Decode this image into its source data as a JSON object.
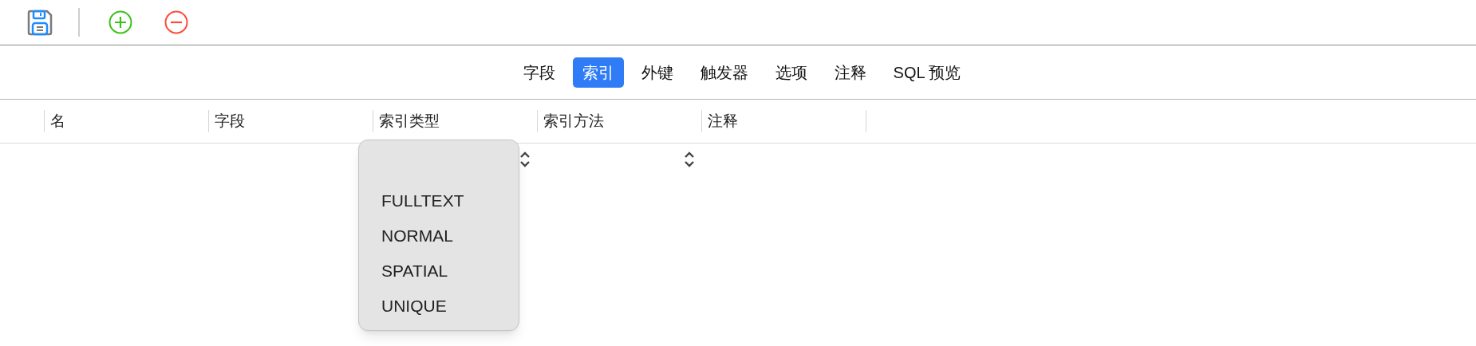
{
  "tabs": [
    {
      "label": "字段",
      "selected": false
    },
    {
      "label": "索引",
      "selected": true
    },
    {
      "label": "外键",
      "selected": false
    },
    {
      "label": "触发器",
      "selected": false
    },
    {
      "label": "选项",
      "selected": false
    },
    {
      "label": "注释",
      "selected": false
    },
    {
      "label": "SQL 预览",
      "selected": false
    }
  ],
  "table": {
    "columns": [
      "名",
      "字段",
      "索引类型",
      "索引方法",
      "注释"
    ],
    "rows": [
      {
        "cells": [
          {
            "kind": "text"
          },
          {
            "kind": "text"
          },
          {
            "kind": "popup"
          },
          {
            "kind": "popup"
          },
          {
            "kind": "text"
          }
        ]
      }
    ]
  },
  "dropdown": {
    "options": [
      "FULLTEXT",
      "NORMAL",
      "SPATIAL",
      "UNIQUE"
    ]
  }
}
